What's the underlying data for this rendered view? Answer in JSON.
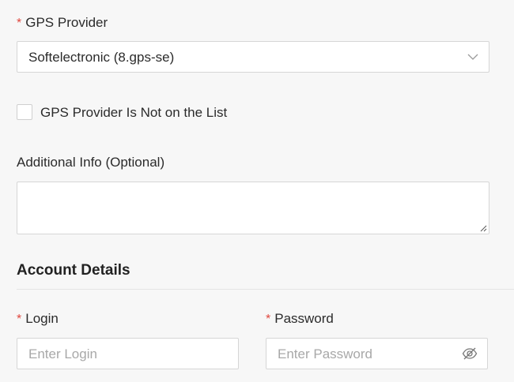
{
  "gps_provider": {
    "label": "GPS Provider",
    "required_mark": "*",
    "selected": "Softelectronic (8.gps-se)"
  },
  "not_on_list": {
    "label": "GPS Provider Is Not on the List",
    "checked": false
  },
  "additional_info": {
    "label": "Additional Info (Optional)",
    "value": ""
  },
  "account_details": {
    "title": "Account Details",
    "login": {
      "label": "Login",
      "required_mark": "*",
      "placeholder": "Enter Login"
    },
    "password": {
      "label": "Password",
      "required_mark": "*",
      "placeholder": "Enter Password"
    }
  },
  "icons": {
    "dropdown": "chevron-down-icon",
    "password_toggle": "eye-off-icon",
    "resize": "resize-handle-icon"
  },
  "colors": {
    "required": "#e0473e",
    "border": "#d6d6d6",
    "placeholder": "#a8a8a8",
    "background": "#f7f7f7"
  }
}
